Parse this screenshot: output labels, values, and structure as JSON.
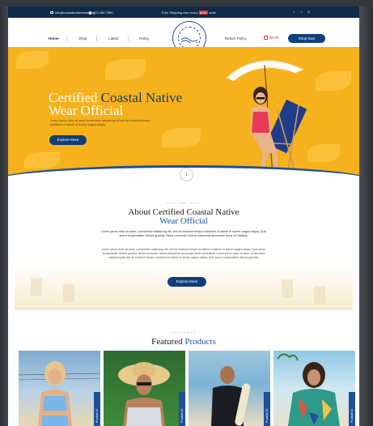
{
  "topbar": {
    "email": "info@coastalnativewear.org",
    "phone": "123 456 7890",
    "promo_before": "Free Shipping over every",
    "promo_highlight": "$150",
    "promo_after": "order",
    "social_icons": [
      "facebook-icon",
      "twitter-icon",
      "instagram-icon"
    ]
  },
  "nav": {
    "left_links": [
      "Home",
      "Shop",
      "Latest",
      "Policy"
    ],
    "return_policy": "Return Policy",
    "cart_amount": "$0.00",
    "shop_now": "Shop Now",
    "logo_text": "CERTIFIED COASTAL NATIVE"
  },
  "hero": {
    "title_white": "Certified",
    "title_blue": "Coastal Native",
    "title_line2": "Wear Official",
    "text": "Lorem ipsum dolor sit amet consectetur adipiscing elit sed do eiusmod tempor incididunt ut labore et dolore magna aliqua.",
    "button": "Explore More",
    "scroll_arrow": "↓",
    "colors": {
      "background": "#f6b21c",
      "accent": "#0f3f7a"
    }
  },
  "about": {
    "kicker": "WHO WE ARE",
    "title_line1": "About Certified Coastal Native",
    "title_line2": "Wear Official",
    "paragraph1": "Lorem ipsum dolor sit amet, consectetur adipiscing elit, sed do eiusmod tempor incididunt ut labore et dolore magna aliqua. Quis ipsum suspendisse ultrices gravida. Risus commodo viverra maecenas accumsan lacus vel facilisis.",
    "paragraph2": "Lorem ipsum dolor sit amet, consectetur adipiscing elit, sed do eiusmod tempor incididunt ut labore et dolore magna aliqua. Quis ipsum suspendisse ultrices gravida. Risus commodo viverra maecenas accumsan lacus vel facilisis. Lorem ipsum dolor sit amet, consectetur adipiscing elit sed do eiusmod tempor incididunt ut labore et dolore magna aliqua. Quis ipsum suspendisse ultrices gravida.",
    "button": "Explore More"
  },
  "featured": {
    "kicker": "FEATURED",
    "title_black": "Featured",
    "title_blue": "Products",
    "products": [
      {
        "tag": "Product 01"
      },
      {
        "tag": "Product 02"
      },
      {
        "tag": "Product 03"
      },
      {
        "tag": "Product 04"
      }
    ]
  }
}
